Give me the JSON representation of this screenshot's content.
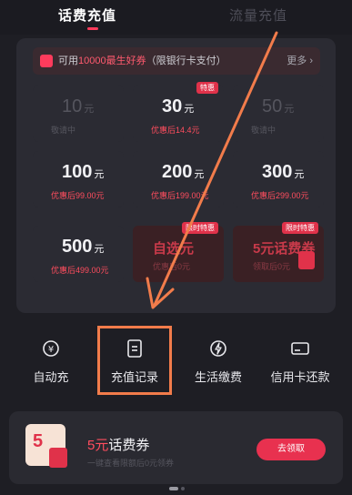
{
  "tabs": [
    {
      "label": "话费充值",
      "active": true
    },
    {
      "label": "流量充值",
      "active": false
    }
  ],
  "promo_bar": {
    "prefix": "可用",
    "highlight": "10000最生好券",
    "suffix": "（限银行卡支付）",
    "more": "更多 ›"
  },
  "recharge_options": [
    {
      "amount": "10",
      "unit": "元",
      "sub": "敬请中",
      "disabled": true
    },
    {
      "amount": "30",
      "unit": "元",
      "sub": "优惠后14.4元",
      "badge": "特惠"
    },
    {
      "amount": "50",
      "unit": "元",
      "sub": "敬请中",
      "disabled": true
    },
    {
      "amount": "100",
      "unit": "元",
      "sub": "优惠后99.00元"
    },
    {
      "amount": "200",
      "unit": "元",
      "sub": "优惠后199.00元"
    },
    {
      "amount": "300",
      "unit": "元",
      "sub": "优惠后299.00元"
    },
    {
      "amount": "500",
      "unit": "元",
      "sub": "优惠后499.00元"
    },
    {
      "amount": "自选元",
      "unit": "",
      "sub": "优惠后0元",
      "badge": "限时特惠",
      "promo": true
    },
    {
      "amount": "5元话费券",
      "unit": "",
      "sub": "领取后0元",
      "badge": "限时特惠",
      "promo": true,
      "coupon": true
    }
  ],
  "quick_actions": [
    {
      "label": "自动充",
      "icon": "auto-recharge-icon"
    },
    {
      "label": "充值记录",
      "icon": "record-document-icon"
    },
    {
      "label": "生活缴费",
      "icon": "bolt-icon"
    },
    {
      "label": "信用卡还款",
      "icon": "credit-card-icon"
    }
  ],
  "banner": {
    "coupon_value": "5",
    "title_highlight": "5元",
    "title": "话费券",
    "subtitle": "一键查看限额后0元领券",
    "button": "去领取"
  },
  "colors": {
    "accent": "#ff3b5c",
    "annotation": "#f27c4b",
    "background": "#1e1e24"
  }
}
